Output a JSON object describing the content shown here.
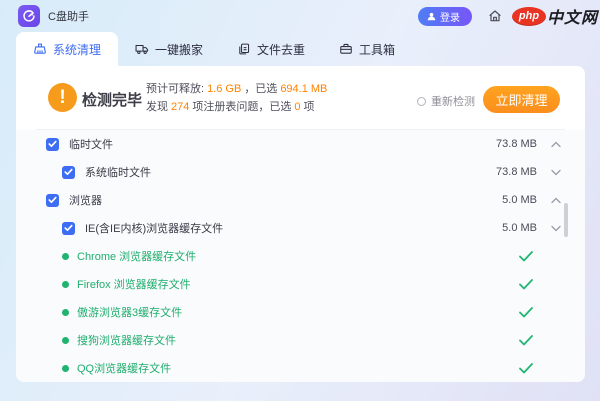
{
  "app": {
    "name": "C盘助手",
    "login_label": "登录",
    "brand_php": "php",
    "brand_suffix": "中文网"
  },
  "tabs": [
    {
      "label": "系统清理",
      "icon": "clean-icon",
      "active": true
    },
    {
      "label": "一键搬家",
      "icon": "truck-icon",
      "active": false
    },
    {
      "label": "文件去重",
      "icon": "dedupe-icon",
      "active": false
    },
    {
      "label": "工具箱",
      "icon": "toolbox-icon",
      "active": false
    }
  ],
  "summary": {
    "status": "检测完毕",
    "release_label": "预计可释放:",
    "release_value": "1.6 GB",
    "selected_label": "，已选",
    "selected_value": "694.1 MB",
    "found_label": "发现",
    "found_value": "274",
    "issues_label": "项注册表问题，已选",
    "selected_count": "0",
    "count_unit": "项"
  },
  "actions": {
    "rescan_label": "重新检测",
    "clean_label": "立即清理"
  },
  "list": {
    "rows": [
      {
        "type": "group",
        "checked": true,
        "label": "临时文件",
        "size": "73.8 MB",
        "chevron": "up"
      },
      {
        "type": "sub",
        "checked": true,
        "label": "系统临时文件",
        "size": "73.8 MB",
        "chevron": "down"
      },
      {
        "type": "group",
        "checked": true,
        "label": "浏览器",
        "size": "5.0 MB",
        "chevron": "up"
      },
      {
        "type": "sub",
        "checked": true,
        "label": "IE(含IE内核)浏览器缓存文件",
        "size": "5.0 MB",
        "chevron": "down"
      },
      {
        "type": "leaf",
        "label": "Chrome 浏览器缓存文件",
        "status": "done"
      },
      {
        "type": "leaf",
        "label": "Firefox 浏览器缓存文件",
        "status": "done"
      },
      {
        "type": "leaf",
        "label": "傲游浏览器3缓存文件",
        "status": "done"
      },
      {
        "type": "leaf",
        "label": "搜狗浏览器缓存文件",
        "status": "done"
      },
      {
        "type": "leaf",
        "label": "QQ浏览器缓存文件",
        "status": "done"
      }
    ]
  },
  "colors": {
    "accent_blue": "#3d6df2",
    "accent_orange": "#fc9220",
    "success_green": "#1fb36f",
    "brand_purple": "#7050ee",
    "brand_red": "#e93323"
  }
}
